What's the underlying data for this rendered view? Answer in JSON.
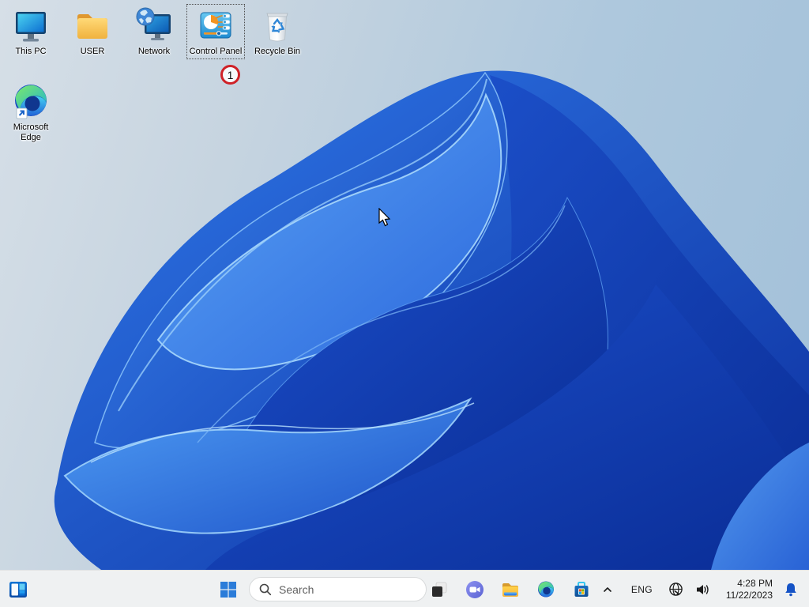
{
  "desktop": {
    "icons": [
      {
        "id": "this-pc",
        "label": "This PC"
      },
      {
        "id": "user-folder",
        "label": "USER"
      },
      {
        "id": "network",
        "label": "Network"
      },
      {
        "id": "control-panel",
        "label": "Control Panel",
        "selected": true
      },
      {
        "id": "recycle-bin",
        "label": "Recycle Bin"
      },
      {
        "id": "microsoft-edge",
        "label": "Microsoft Edge"
      }
    ],
    "annotation_badge": "1"
  },
  "taskbar": {
    "search_placeholder": "Search",
    "icons": [
      "start",
      "task-view",
      "chat",
      "file-explorer",
      "edge",
      "microsoft-store"
    ],
    "tray": {
      "language_label": "ENG",
      "time": "4:28 PM",
      "date": "11/22/2023"
    }
  },
  "colors": {
    "taskbar_bg": "#eff1f2",
    "start_blue": "#2b7cd9",
    "bell_blue": "#1553c6",
    "badge_red": "#cf2127",
    "wallpaper_deep_blue": "#0c2f9e",
    "wallpaper_light_blue": "#5ba4f6",
    "desktop_bg": "#aec8dd"
  }
}
